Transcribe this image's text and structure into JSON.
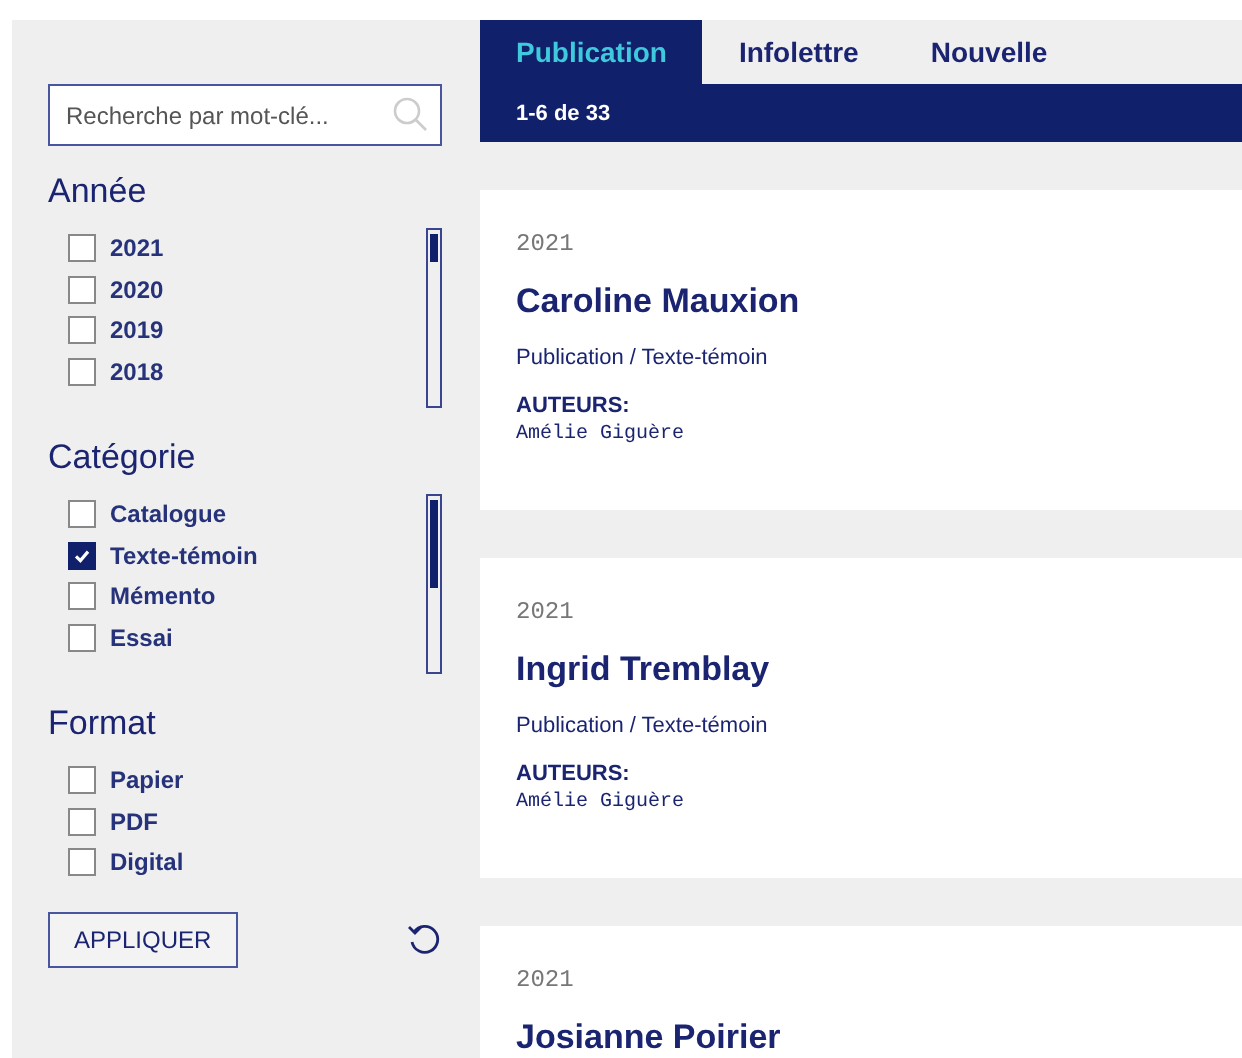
{
  "search": {
    "placeholder": "Recherche par mot-clé..."
  },
  "filters": [
    {
      "title": "Année",
      "scroll": true,
      "options": [
        {
          "label": "2021",
          "checked": false
        },
        {
          "label": "2020",
          "checked": false
        },
        {
          "label": "2019",
          "checked": false
        },
        {
          "label": "2018",
          "checked": false
        }
      ]
    },
    {
      "title": "Catégorie",
      "scroll": true,
      "options": [
        {
          "label": "Catalogue",
          "checked": false
        },
        {
          "label": "Texte-témoin",
          "checked": true
        },
        {
          "label": "Mémento",
          "checked": false
        },
        {
          "label": "Essai",
          "checked": false
        }
      ]
    },
    {
      "title": "Format",
      "scroll": false,
      "options": [
        {
          "label": "Papier",
          "checked": false
        },
        {
          "label": "PDF",
          "checked": false
        },
        {
          "label": "Digital",
          "checked": false
        }
      ]
    }
  ],
  "apply_button": "APPLIQUER",
  "tabs": [
    {
      "label": "Publication",
      "selected": true
    },
    {
      "label": "Infolettre",
      "selected": false
    },
    {
      "label": "Nouvelle",
      "selected": false
    }
  ],
  "result_count": "1-6 de 33",
  "results": [
    {
      "year": "2021",
      "title": "Caroline Mauxion",
      "category": "Publication / Texte-témoin",
      "authors_label": "AUTEURS:",
      "authors": "Amélie Giguère"
    },
    {
      "year": "2021",
      "title": "Ingrid Tremblay",
      "category": "Publication / Texte-témoin",
      "authors_label": "AUTEURS:",
      "authors": "Amélie Giguère"
    },
    {
      "year": "2021",
      "title": "Josianne Poirier"
    }
  ]
}
